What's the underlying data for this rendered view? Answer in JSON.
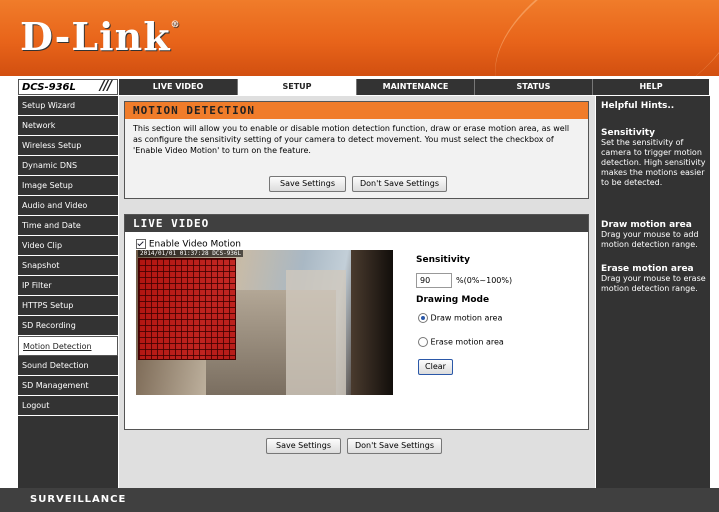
{
  "brand": {
    "logo": "D-Link",
    "trademark": "®"
  },
  "model": {
    "name": "DCS-936L",
    "slashes": "///"
  },
  "tabs": [
    {
      "label": "LIVE VIDEO",
      "active": false
    },
    {
      "label": "SETUP",
      "active": true
    },
    {
      "label": "MAINTENANCE",
      "active": false
    },
    {
      "label": "STATUS",
      "active": false
    },
    {
      "label": "HELP",
      "active": false
    }
  ],
  "sidebar": {
    "items": [
      {
        "label": "Setup Wizard"
      },
      {
        "label": "Network"
      },
      {
        "label": "Wireless Setup"
      },
      {
        "label": "Dynamic DNS"
      },
      {
        "label": "Image Setup"
      },
      {
        "label": "Audio and Video"
      },
      {
        "label": "Time and Date"
      },
      {
        "label": "Video Clip"
      },
      {
        "label": "Snapshot"
      },
      {
        "label": "IP Filter"
      },
      {
        "label": "HTTPS Setup"
      },
      {
        "label": "SD Recording"
      },
      {
        "label": "Motion Detection"
      },
      {
        "label": "Sound Detection"
      },
      {
        "label": "SD Management"
      },
      {
        "label": "Logout"
      }
    ],
    "active_index": 12
  },
  "motion": {
    "title": "MOTION DETECTION",
    "description": "This section will allow you to enable or disable motion detection function, draw or erase motion area, as well as configure the sensitivity setting of your camera to detect movement. You must select the checkbox of 'Enable Video Motion' to turn on the feature.",
    "save_label": "Save Settings",
    "dont_save_label": "Don't Save Settings"
  },
  "live": {
    "title": "LIVE VIDEO",
    "enable_label": "Enable Video Motion",
    "enable_checked": true,
    "timestamp": "2014/01/01 01:37:28 DCS-936L",
    "sensitivity_label": "Sensitivity",
    "sensitivity_value": "90",
    "sensitivity_range": "%(0%~100%)",
    "drawing_mode_label": "Drawing Mode",
    "draw_label": "Draw motion area",
    "erase_label": "Erase motion area",
    "clear_label": "Clear"
  },
  "bottom": {
    "save_label": "Save Settings",
    "dont_save_label": "Don't Save Settings"
  },
  "hints": {
    "title": "Helpful Hints..",
    "sections": [
      {
        "title": "Sensitivity",
        "body": "Set the sensitivity of camera to trigger motion detection. High sensitivity makes the motions easier to be detected."
      },
      {
        "title": "Draw motion area",
        "body": "Drag your mouse to add motion detection range."
      },
      {
        "title": "Erase motion area",
        "body": "Drag your mouse to erase motion detection range."
      }
    ]
  },
  "footer": {
    "label": "SURVEILLANCE"
  },
  "colors": {
    "accent": "#f07c2a",
    "dark": "#333333",
    "panel": "#dfdfdf"
  }
}
